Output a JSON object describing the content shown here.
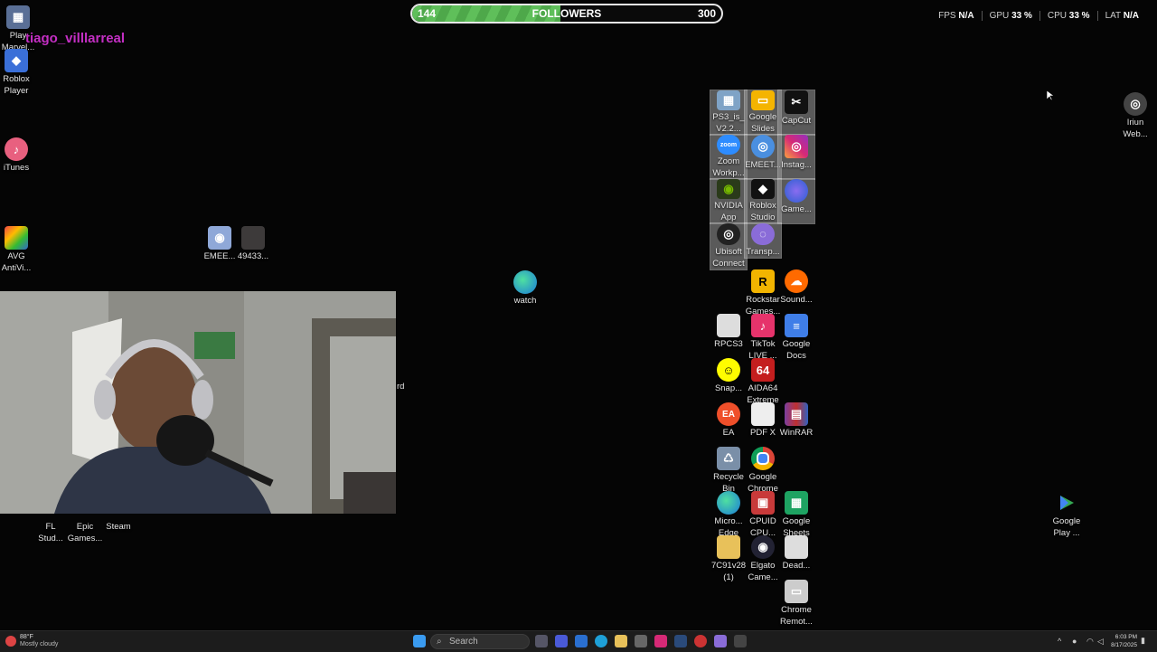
{
  "overlay": {
    "username": "tiago_villlarreal",
    "follower_goal": {
      "current": "144",
      "label": "FOLLOWERS",
      "target": "300",
      "progress": 0.48
    },
    "stats": [
      {
        "label": "FPS",
        "value": "N/A"
      },
      {
        "label": "GPU",
        "value": "33 %"
      },
      {
        "label": "CPU",
        "value": "33 %"
      },
      {
        "label": "LAT",
        "value": "N/A"
      }
    ]
  },
  "desktop": {
    "icons": {
      "play_marvel": "Play\nMarvel...",
      "roblox_player": "Roblox\nPlayer",
      "itunes": "iTunes",
      "avg": "AVG\nAntiVi...",
      "emeet1": "EMEE...",
      "num49433": "49433...",
      "watch": "watch",
      "fl_studio": "FL\nStud...",
      "epic": "Epic\nGames...",
      "steam": "Steam",
      "ps3": "PS3_is_\nV2.2...",
      "google_slides": "Google\nSlides",
      "capcut": "CapCut",
      "zoom": "Zoom\nWorkp...",
      "emeet2": "EMEET...",
      "instagram": "Instag...",
      "nvidia": "NVIDIA\nApp",
      "roblox_studio": "Roblox\nStudio",
      "game": "Game...",
      "ubisoft": "Ubisoft\nConnect",
      "transp": "Transp...",
      "rockstar": "Rockstar\nGames...",
      "soundcloud": "Sound...",
      "rpcs3": "RPCS3",
      "tiktok": "TikTok\nLIVE ...",
      "google_docs": "Google\nDocs",
      "snap": "Snap...",
      "aida64": "AIDA64\nExtreme",
      "ea": "EA",
      "pdfx": "PDF X",
      "winrar": "WinRAR",
      "recycle": "Recycle\nBin",
      "chrome": "Google\nChrome",
      "edge": "Micro...\nEdge",
      "cpuid": "CPUID\nCPU...",
      "sheets": "Google\nSheets",
      "folder7c": "7C91v28\n(1)",
      "elgato": "Elgato\nCame...",
      "dead": "Dead...",
      "chrome_remote": "Chrome\nRemot...",
      "iriun": "Iriun\nWeb...",
      "google_play": "Google\nPlay ..."
    },
    "partial_label": "rd"
  },
  "taskbar": {
    "search_placeholder": "Search",
    "weather": {
      "temp": "88°F",
      "desc": "Mostly cloudy"
    },
    "time": "6:03 PM",
    "date": "8/17/2025"
  },
  "colors": {
    "accent_green": "#5fbf5a",
    "username": "#c42fc4"
  }
}
